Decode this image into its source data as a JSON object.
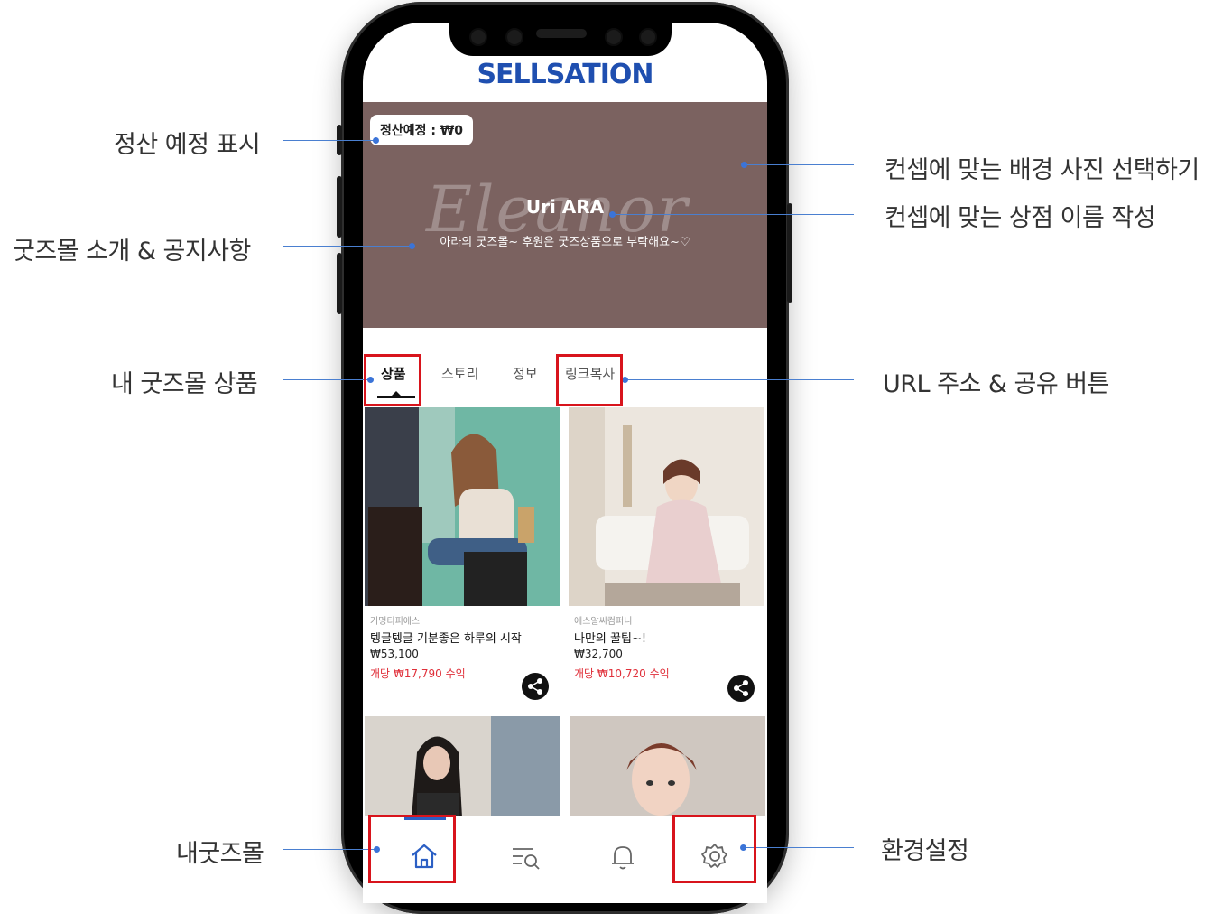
{
  "app": {
    "logo": "SELLSATION",
    "settlement_badge": "정산예정 : ₩0",
    "banner": {
      "script_text": "Eleanor",
      "shop_name": "Uri ARA",
      "description": "아라의 굿즈몰~ 후원은 굿즈상품으로 부탁해요~♡"
    },
    "tabs": [
      {
        "label": "상품",
        "active": true
      },
      {
        "label": "스토리",
        "active": false
      },
      {
        "label": "정보",
        "active": false
      },
      {
        "label": "링크복사",
        "active": false
      }
    ],
    "products": [
      {
        "seller": "거멍티피에스",
        "name": "텡글텡글 기분좋은 하루의 시작",
        "price": "₩53,100",
        "profit": "개당 ₩17,790 수익"
      },
      {
        "seller": "에스알씨컴퍼니",
        "name": "나만의 꿀팁~!",
        "price": "₩32,700",
        "profit": "개당 ₩10,720 수익"
      }
    ],
    "bottom_nav": [
      "home-icon",
      "search-list-icon",
      "bell-icon",
      "gear-icon"
    ]
  },
  "annotations": {
    "settlement": "정산 예정 표시",
    "intro": "굿즈몰 소개 & 공지사항",
    "products": "내 굿즈몰 상품",
    "my_mall": "내굿즈몰",
    "background": "컨셉에 맞는 배경 사진 선택하기",
    "shop_name": "컨셉에 맞는 상점 이름 작성",
    "url_share": "URL 주소 & 공유 버튼",
    "settings": "환경설정"
  },
  "colors": {
    "accent": "#1f4fb0",
    "banner": "#7b6260",
    "highlight": "#d8141c",
    "profit": "#e0303a",
    "annotation_line": "#4a7fd0"
  }
}
